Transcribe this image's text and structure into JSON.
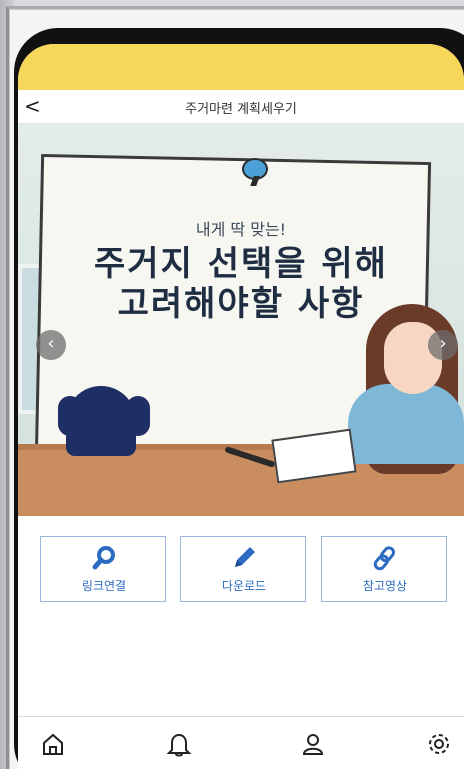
{
  "header": {
    "back_label": "<",
    "title": "주거마련 계획세우기"
  },
  "banner": {
    "subtitle": "내게 딱 맞는!",
    "line1": "주거지 선택을 위해",
    "line2": "고려해야할 사항",
    "prev_label": "‹",
    "next_label": "›"
  },
  "actions": [
    {
      "label": "링크연결",
      "icon": "search-icon"
    },
    {
      "label": "다운로드",
      "icon": "pencil-icon"
    },
    {
      "label": "참고영상",
      "icon": "link-icon"
    }
  ],
  "bottom_nav": [
    {
      "icon": "home-icon"
    },
    {
      "icon": "bell-icon"
    },
    {
      "icon": "user-icon"
    },
    {
      "icon": "gear-icon"
    }
  ],
  "colors": {
    "status_band": "#f6d75a",
    "accent_blue": "#2c6bbf",
    "button_border": "#9db6de"
  }
}
